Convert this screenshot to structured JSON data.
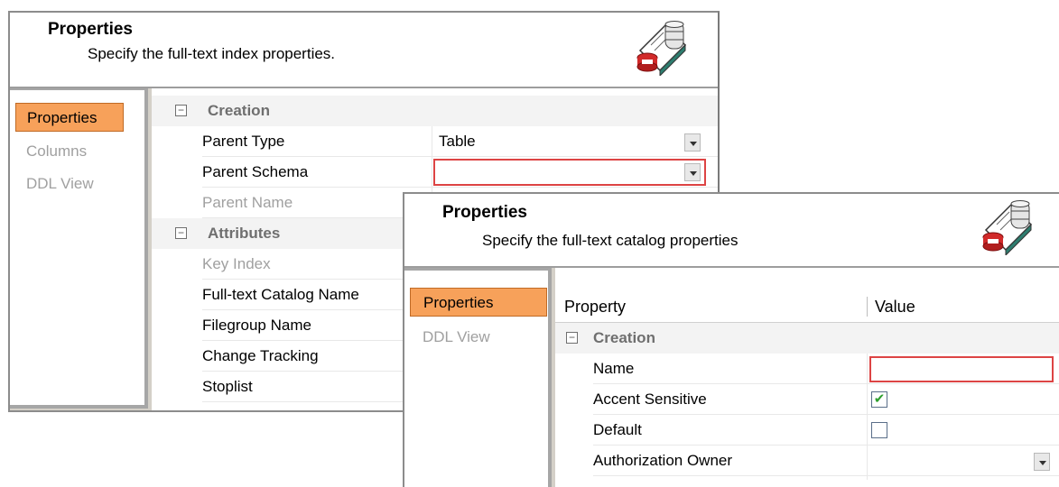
{
  "window_index": {
    "title": "Properties",
    "subtitle": "Specify the full-text index properties.",
    "nav": [
      "Properties",
      "Columns",
      "DDL View"
    ],
    "groups": [
      {
        "name": "Creation",
        "rows": [
          {
            "name": "Parent Type",
            "value": "Table",
            "dropdown": true
          },
          {
            "name": "Parent Schema",
            "value": "",
            "dropdown": true,
            "required": true
          },
          {
            "name": "Parent Name",
            "value": "",
            "disabled": true
          }
        ]
      },
      {
        "name": "Attributes",
        "rows": [
          {
            "name": "Key Index",
            "disabled": true
          },
          {
            "name": "Full-text Catalog Name"
          },
          {
            "name": "Filegroup Name"
          },
          {
            "name": "Change Tracking"
          },
          {
            "name": "Stoplist"
          }
        ]
      }
    ]
  },
  "window_catalog": {
    "title": "Properties",
    "subtitle": "Specify the full-text catalog properties",
    "nav": [
      "Properties",
      "DDL View"
    ],
    "columns": [
      "Property",
      "Value"
    ],
    "group": "Creation",
    "rows": [
      {
        "name": "Name",
        "type": "text",
        "required": true
      },
      {
        "name": "Accent Sensitive",
        "type": "checkbox",
        "checked": true
      },
      {
        "name": "Default",
        "type": "checkbox",
        "checked": false
      },
      {
        "name": "Authorization Owner",
        "type": "dropdown"
      }
    ]
  },
  "colors": {
    "accent": "#f7a15a",
    "required_border": "#dd4444",
    "panel_gray": "#d4d0c8"
  },
  "icons": [
    "database-properties-icon",
    "collapse-icon",
    "dropdown-arrow-icon",
    "checkmark-icon"
  ]
}
